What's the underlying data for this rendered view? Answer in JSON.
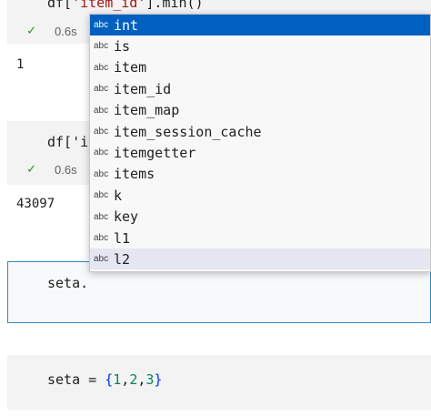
{
  "cells": [
    {
      "code_prefix": "df[",
      "code_string": "'item_id'",
      "code_suffix": "].min()",
      "status_time": "0.6s",
      "output": "1"
    },
    {
      "code_visible": "df['i",
      "status_time": "0.6s",
      "output": "43097"
    },
    {
      "code": "seta."
    },
    {
      "code_prefix": "seta = ",
      "brace_open": "{",
      "n1": "1",
      "sep1": ",",
      "n2": "2",
      "sep2": ",",
      "n3": "3",
      "brace_close": "}"
    }
  ],
  "suggestions": {
    "icon_label": "abc",
    "items": [
      "int",
      "is",
      "item",
      "item_id",
      "item_map",
      "item_session_cache",
      "itemgetter",
      "items",
      "k",
      "key",
      "l1",
      "l2"
    ],
    "selected_index": 0,
    "hover_index": 11
  },
  "colors": {
    "selected": "#0060c0",
    "check": "#388a34",
    "active_border": "#2f8bc2"
  }
}
